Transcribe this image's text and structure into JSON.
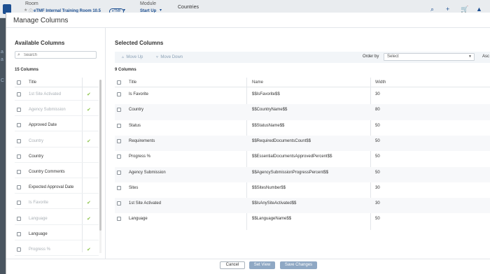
{
  "header": {
    "room_label": "Room",
    "room_value": "eTMF Internal Training Room 10.5",
    "room_tag": "eTMF",
    "module_label": "Module",
    "module_value": "Start Up",
    "current_tab": "Countries",
    "icons": [
      "search-icon",
      "plus-icon",
      "cart-icon",
      "bell-icon"
    ]
  },
  "modal": {
    "title": "Manage Columns",
    "available": {
      "heading": "Available Columns",
      "search_placeholder": "Search",
      "count_label": "15 Columns",
      "column_header": "Title",
      "rows": [
        {
          "title": "1st Site Activated",
          "selected": true
        },
        {
          "title": "Agency Submission",
          "selected": true
        },
        {
          "title": "Approved Date",
          "selected": false
        },
        {
          "title": "Country",
          "selected": true
        },
        {
          "title": "Country",
          "selected": false
        },
        {
          "title": "Country Comments",
          "selected": false
        },
        {
          "title": "Expected Approval Date",
          "selected": false
        },
        {
          "title": "Is Favorite",
          "selected": true
        },
        {
          "title": "Language",
          "selected": true
        },
        {
          "title": "Language",
          "selected": false
        },
        {
          "title": "Progress %",
          "selected": true
        }
      ]
    },
    "selected": {
      "heading": "Selected Columns",
      "move_up": "Move Up",
      "move_down": "Move Down",
      "order_by_label": "Order by",
      "order_by_value": "Select",
      "asc_label": "Asc",
      "count_label": "9 Columns",
      "columns": {
        "title": "Title",
        "name": "Name",
        "width": "Width"
      },
      "rows": [
        {
          "title": "Is Favorite",
          "name": "$$IsFavorite$$",
          "width": "30"
        },
        {
          "title": "Country",
          "name": "$$CountryName$$",
          "width": "80"
        },
        {
          "title": "Status",
          "name": "$$StatusName$$",
          "width": "50"
        },
        {
          "title": "Requirements",
          "name": "$$RequiredDocumentsCount$$",
          "width": "50"
        },
        {
          "title": "Progress %",
          "name": "$$EssentialDocumentsApprovedPercent$$",
          "width": "50"
        },
        {
          "title": "Agency Submission",
          "name": "$$AgencySubmissionProgressPercent$$",
          "width": "50"
        },
        {
          "title": "Sites",
          "name": "$$SitesNumber$$",
          "width": "30"
        },
        {
          "title": "1st Site Activated",
          "name": "$$IsAnySiteActivated$$",
          "width": "30"
        },
        {
          "title": "Language",
          "name": "$$LanguageName$$",
          "width": "50"
        }
      ]
    },
    "footer": {
      "cancel": "Cancel",
      "set_view": "Set View",
      "save_changes": "Save Changes"
    }
  },
  "colors": {
    "brand": "#1d4f91",
    "check": "#8bc34a",
    "primary_button": "#8fa8c4"
  }
}
